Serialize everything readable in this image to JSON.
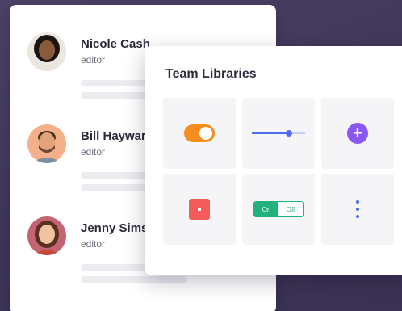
{
  "members": [
    {
      "name": "Nicole Cash",
      "role": "editor",
      "avatar": {
        "skin": "#8a5a3c",
        "hair": "#1c1410",
        "shirt": "#e9e3dc",
        "bg": "#ece6e0"
      }
    },
    {
      "name": "Bill Hayward",
      "role": "editor",
      "avatar": {
        "skin": "#e2a27a",
        "hair": "#4a2f20",
        "shirt": "#7f8fa0",
        "bg": "#f3b08a"
      }
    },
    {
      "name": "Jenny Sims",
      "role": "editor",
      "avatar": {
        "skin": "#f0c2a0",
        "hair": "#5a2f22",
        "shirt": "#c4493b",
        "bg": "#c46470"
      }
    }
  ],
  "libraries": {
    "title": "Team Libraries",
    "switch_labels": {
      "on": "On",
      "off": "Off"
    }
  },
  "colors": {
    "toggle": "#f68d1f",
    "accent_blue": "#4f6bf0",
    "add_purple": "#8a57f2",
    "stop_red": "#f45b5b",
    "switch_green": "#20b27a"
  },
  "icons": [
    "toggle-switch-icon",
    "slider-icon",
    "add-circle-icon",
    "stop-square-icon",
    "on-off-switch-icon",
    "more-vertical-icon"
  ]
}
